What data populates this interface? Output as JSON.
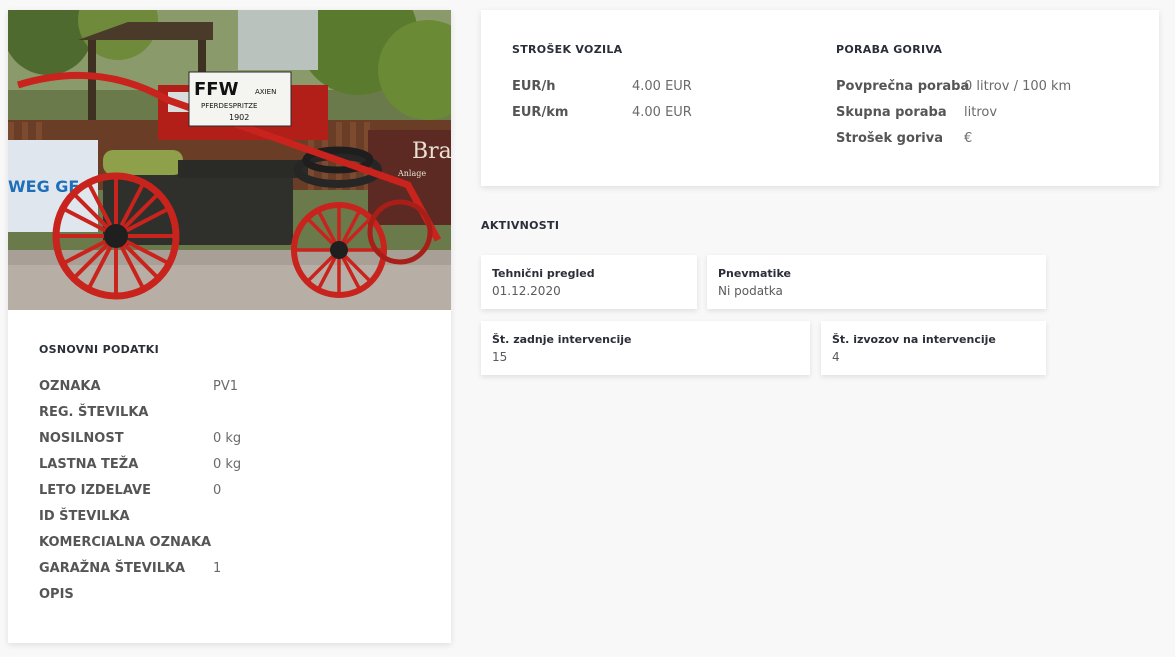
{
  "basic_info": {
    "title": "OSNOVNI PODATKI",
    "rows": [
      {
        "label": "OZNAKA",
        "value": "PV1"
      },
      {
        "label": "REG. ŠTEVILKA",
        "value": ""
      },
      {
        "label": "NOSILNOST",
        "value": "0 kg"
      },
      {
        "label": "LASTNA TEŽA",
        "value": "0 kg"
      },
      {
        "label": "LETO IZDELAVE",
        "value": "0"
      },
      {
        "label": "ID ŠTEVILKA",
        "value": ""
      },
      {
        "label": "KOMERCIALNA OZNAKA",
        "value": ""
      },
      {
        "label": "GARAŽNA ŠTEVILKA",
        "value": "1"
      },
      {
        "label": "OPIS",
        "value": ""
      }
    ]
  },
  "photo": {
    "sign_line1": "FFW",
    "sign_line1b": "AXIEN",
    "sign_line2": "PFERDESPRITZE",
    "sign_line3": "1902",
    "banner_text": "WEG GE",
    "banner_text2": "Bra",
    "banner_small": "Anlage"
  },
  "vehicle_cost": {
    "title": "STROŠEK VOZILA",
    "rows": [
      {
        "label": "EUR/h",
        "value": "4.00 EUR"
      },
      {
        "label": "EUR/km",
        "value": "4.00 EUR"
      }
    ]
  },
  "fuel": {
    "title": "PORABA GORIVA",
    "rows": [
      {
        "label": "Povprečna poraba",
        "value": "0 litrov / 100 km"
      },
      {
        "label": "Skupna poraba",
        "value": "litrov"
      },
      {
        "label": "Strošek goriva",
        "value": "€"
      }
    ]
  },
  "activities": {
    "title": "AKTIVNOSTI",
    "items": [
      {
        "label": "Tehnični pregled",
        "value": "01.12.2020"
      },
      {
        "label": "Pnevmatike",
        "value": "Ni podatka"
      },
      {
        "label": "Št. zadnje intervencije",
        "value": "15"
      },
      {
        "label": "Št. izvozov na intervencije",
        "value": "4"
      }
    ]
  },
  "colors": {
    "page_bg": "#f8f8f8",
    "card_bg": "#ffffff",
    "heading": "#2a2e38",
    "label": "#555555",
    "value": "#6a6a6a",
    "wheel_red": "#c8231c"
  }
}
